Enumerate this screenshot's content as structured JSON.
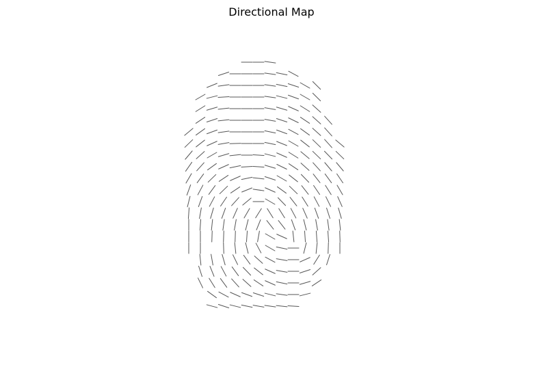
{
  "chart_data": {
    "type": "quiver",
    "title": "Directional Map",
    "xlabel": "",
    "ylabel": "",
    "axes_visible": false,
    "grid": false,
    "legend": "none",
    "line_color": "#555555",
    "background": "#ffffff",
    "columns": [
      276,
      293,
      310,
      327,
      344,
      361,
      378,
      395,
      412,
      429,
      446,
      463,
      480,
      497
    ],
    "rows": [
      91,
      108,
      125,
      142,
      159,
      176,
      193,
      210,
      227,
      244,
      261,
      278,
      295,
      312,
      329,
      346,
      363,
      380,
      397,
      414,
      431,
      448
    ],
    "angles_deg": [
      [
        null,
        null,
        null,
        null,
        null,
        0,
        0,
        -8,
        null,
        null,
        null,
        null,
        null,
        null
      ],
      [
        null,
        null,
        null,
        18,
        0,
        0,
        0,
        -8,
        -12,
        -28,
        null,
        null,
        null,
        null
      ],
      [
        null,
        null,
        22,
        8,
        0,
        0,
        0,
        -8,
        -12,
        -18,
        -30,
        -45,
        null,
        null
      ],
      [
        null,
        30,
        14,
        4,
        0,
        0,
        0,
        -8,
        -14,
        -20,
        -30,
        -45,
        null,
        null
      ],
      [
        null,
        32,
        16,
        6,
        0,
        0,
        0,
        -10,
        -16,
        -24,
        -32,
        -42,
        null,
        null
      ],
      [
        null,
        34,
        18,
        6,
        0,
        0,
        0,
        -10,
        -18,
        -26,
        -34,
        -42,
        -48,
        null
      ],
      [
        40,
        36,
        20,
        8,
        0,
        0,
        0,
        -12,
        -20,
        -28,
        -36,
        -42,
        -48,
        null
      ],
      [
        44,
        38,
        24,
        10,
        2,
        0,
        0,
        -12,
        -22,
        -30,
        -38,
        -44,
        -48,
        -40
      ],
      [
        50,
        42,
        30,
        16,
        6,
        0,
        -4,
        -14,
        -24,
        -32,
        -40,
        -44,
        -46,
        -44
      ],
      [
        55,
        48,
        36,
        24,
        12,
        4,
        -4,
        -16,
        -26,
        -34,
        -42,
        -48,
        -50,
        -50
      ],
      [
        60,
        54,
        44,
        34,
        24,
        12,
        -6,
        -18,
        -30,
        -38,
        -46,
        -52,
        -54,
        -56
      ],
      [
        70,
        62,
        54,
        44,
        34,
        22,
        -8,
        -24,
        -36,
        -44,
        -52,
        -56,
        -58,
        -60
      ],
      [
        76,
        70,
        62,
        56,
        48,
        40,
        0,
        -30,
        -46,
        -52,
        -58,
        -62,
        -64,
        -66
      ],
      [
        86,
        80,
        74,
        70,
        66,
        60,
        58,
        -58,
        -58,
        -62,
        -66,
        -70,
        -72,
        -74
      ],
      [
        90,
        86,
        84,
        82,
        80,
        76,
        68,
        -52,
        -52,
        -70,
        -76,
        -80,
        -82,
        -84
      ],
      [
        90,
        90,
        88,
        88,
        88,
        86,
        80,
        -30,
        -24,
        -84,
        -86,
        -86,
        -86,
        -88
      ],
      [
        90,
        90,
        null,
        92,
        96,
        104,
        118,
        150,
        -12,
        0,
        76,
        84,
        88,
        90
      ],
      [
        null,
        96,
        100,
        106,
        116,
        126,
        138,
        152,
        170,
        0,
        24,
        58,
        72,
        null
      ],
      [
        null,
        108,
        112,
        118,
        126,
        134,
        142,
        156,
        170,
        0,
        18,
        42,
        null,
        null
      ],
      [
        null,
        116,
        122,
        126,
        132,
        138,
        146,
        156,
        168,
        0,
        16,
        34,
        null,
        null
      ],
      [
        null,
        null,
        144,
        152,
        156,
        160,
        162,
        166,
        172,
        0,
        14,
        null,
        null,
        null
      ],
      [
        null,
        null,
        165,
        162,
        166,
        168,
        170,
        172,
        174,
        176,
        null,
        null,
        null,
        null
      ]
    ]
  }
}
